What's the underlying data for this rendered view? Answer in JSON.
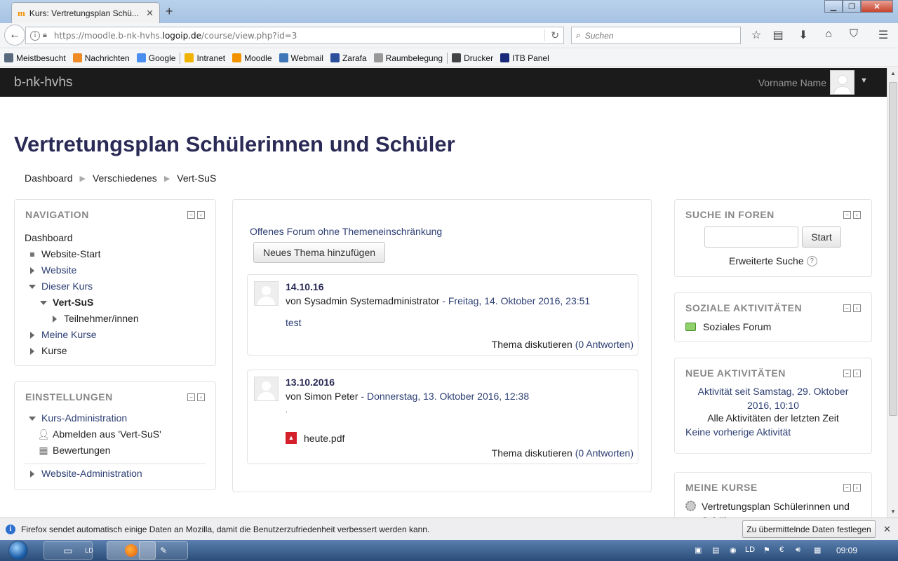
{
  "browser": {
    "tab_title": "Kurs: Vertretungsplan Schü...",
    "tab_favicon": "m",
    "url_prefix": "https://moodle.b-nk-hvhs.",
    "url_domain": "logoip.de",
    "url_path": "/course/view.php?id=3",
    "search_placeholder": "Suchen",
    "bookmarks": [
      {
        "label": "Meistbesucht",
        "icon": "gear-icon",
        "color": "#5a6a7e"
      },
      {
        "label": "Nachrichten",
        "icon": "rss-icon",
        "color": "#f08a24"
      },
      {
        "label": "Google",
        "icon": "google-icon",
        "color": "#4a8ef0"
      },
      {
        "label": "Intranet",
        "icon": "star-icon",
        "color": "#f0b400"
      },
      {
        "label": "Moodle",
        "icon": "moodle-icon",
        "color": "#f39200"
      },
      {
        "label": "Webmail",
        "icon": "webmail-icon",
        "color": "#3f76b8"
      },
      {
        "label": "Zarafa",
        "icon": "zarafa-icon",
        "color": "#2c4f9c"
      },
      {
        "label": "Raumbelegung",
        "icon": "calendar-icon",
        "color": "#999999"
      },
      {
        "label": "Drucker",
        "icon": "printer-icon",
        "color": "#444444"
      },
      {
        "label": "ITB Panel",
        "icon": "panel-icon",
        "color": "#1a2a7a"
      }
    ]
  },
  "moodle": {
    "brand": "b-nk-hvhs",
    "user_name": "Vorname Name",
    "page_title": "Vertretungsplan Schülerinnen und Schüler",
    "breadcrumb": [
      "Dashboard",
      "Verschiedenes",
      "Vert-SuS"
    ],
    "navigation": {
      "title": "NAVIGATION",
      "dashboard": "Dashboard",
      "site_home": "Website-Start",
      "site": "Website",
      "this_course": "Dieser Kurs",
      "course": "Vert-SuS",
      "participants": "Teilnehmer/innen",
      "my_courses": "Meine Kurse",
      "courses": "Kurse"
    },
    "settings": {
      "title": "EINSTELLUNGEN",
      "course_admin": "Kurs-Administration",
      "unenrol": "Abmelden aus 'Vert-SuS'",
      "grades": "Bewertungen",
      "site_admin": "Website-Administration"
    },
    "forum": {
      "intro": "Offenes Forum ohne Themeneinschränkung",
      "new_topic": "Neues Thema hinzufügen",
      "posts": [
        {
          "subject": "14.10.16",
          "by_prefix": "von",
          "author": "Sysadmin Systemadministrator",
          "date": " - Freitag, 14. Oktober 2016, 23:51",
          "body": "test",
          "attachment": "",
          "discuss": "Thema diskutieren",
          "replies": "(0 Antworten)"
        },
        {
          "subject": "13.10.2016",
          "by_prefix": "von",
          "author": "Simon Peter",
          "date": " - Donnerstag, 13. Oktober 2016, 12:38",
          "body": ".",
          "attachment": "heute.pdf",
          "discuss": "Thema diskutieren",
          "replies": "(0 Antworten)"
        }
      ]
    },
    "search_forums": {
      "title": "SUCHE IN FOREN",
      "button": "Start",
      "advanced": "Erweiterte Suche"
    },
    "social": {
      "title": "SOZIALE AKTIVITÄTEN",
      "forum": "Soziales Forum"
    },
    "recent": {
      "title": "NEUE AKTIVITÄTEN",
      "since": "Aktivität seit Samstag, 29. Oktober 2016, 10:10",
      "all": "Alle Aktivitäten der letzten Zeit",
      "none": "Keine vorherige Aktivität"
    },
    "mycourses": {
      "title": "MEINE KURSE",
      "course": "Vertretungsplan Schülerinnen und Schüler"
    }
  },
  "notification": {
    "text": "Firefox sendet automatisch einige Daten an Mozilla, damit die Benutzerzufriedenheit verbessert werden kann.",
    "button": "Zu übermittelnde Daten festlegen"
  },
  "taskbar": {
    "clock": "09:09"
  },
  "colors": {
    "title": "#2a2a56",
    "link": "#2d3f73",
    "navbar": "#1b1b1b"
  }
}
